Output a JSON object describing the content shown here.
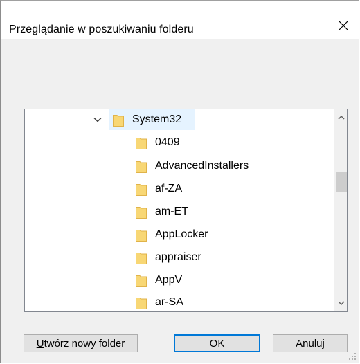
{
  "window": {
    "title": "Przeglądanie w poszukiwaniu folderu"
  },
  "tree": {
    "parent": {
      "label": "System32",
      "expanded": true,
      "icon": "folder-icon"
    },
    "items": [
      {
        "label": "0409",
        "icon": "folder-icon"
      },
      {
        "label": "AdvancedInstallers",
        "icon": "folder-icon"
      },
      {
        "label": "af-ZA",
        "icon": "folder-icon"
      },
      {
        "label": "am-ET",
        "icon": "folder-icon"
      },
      {
        "label": "AppLocker",
        "icon": "folder-icon"
      },
      {
        "label": "appraiser",
        "icon": "folder-icon"
      },
      {
        "label": "AppV",
        "icon": "folder-icon"
      },
      {
        "label": "ar-SA",
        "icon": "folder-icon"
      }
    ]
  },
  "buttons": {
    "new_folder_mnemonic": "U",
    "new_folder_rest": "twórz nowy folder",
    "ok": "OK",
    "cancel": "Anuluj"
  },
  "colors": {
    "selection": "#e5f3ff",
    "folder": "#f8d775",
    "default_button_border": "#0078d7"
  }
}
